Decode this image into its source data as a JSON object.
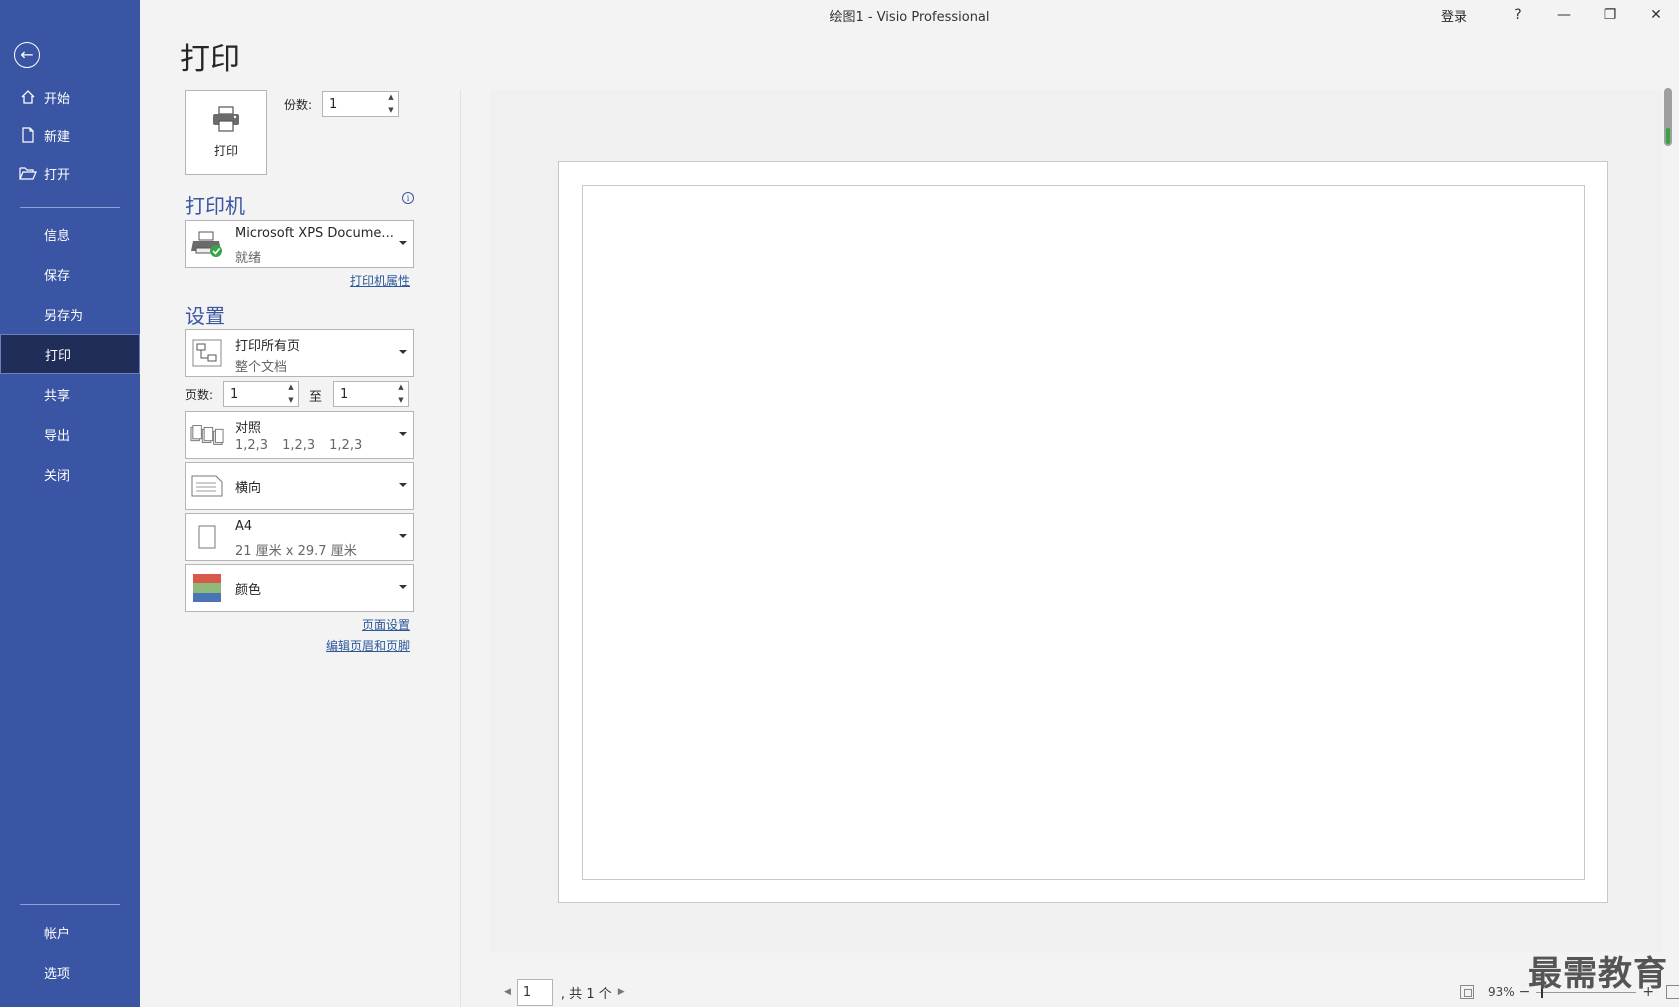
{
  "window": {
    "title": "绘图1  -  Visio Professional",
    "signin": "登录",
    "help": "?",
    "minimize": "—",
    "restore": "❐",
    "close": "✕"
  },
  "sidebar": {
    "back_icon": "←",
    "items": [
      {
        "label": "开始",
        "icon": "home-icon"
      },
      {
        "label": "新建",
        "icon": "new-document-icon"
      },
      {
        "label": "打开",
        "icon": "open-folder-icon"
      },
      {
        "label": "信息"
      },
      {
        "label": "保存"
      },
      {
        "label": "另存为"
      },
      {
        "label": "打印",
        "active": true
      },
      {
        "label": "共享"
      },
      {
        "label": "导出"
      },
      {
        "label": "关闭"
      },
      {
        "label": "帐户"
      },
      {
        "label": "选项"
      }
    ]
  },
  "page": {
    "heading": "打印",
    "print_button_label": "打印",
    "copies_label": "份数:",
    "copies_value": "1",
    "printer_section": "打印机",
    "printer_name": "Microsoft XPS Docume...",
    "printer_status": "就绪",
    "printer_properties": "打印机属性",
    "settings_section": "设置",
    "range_main": "打印所有页",
    "range_sub": "整个文档",
    "pages_label": "页数:",
    "page_from": "1",
    "to_label": "至",
    "page_to": "1",
    "collate_main": "对照",
    "collate_sub": [
      "1,2,3",
      "1,2,3",
      "1,2,3"
    ],
    "orientation": "横向",
    "paper_main": "A4",
    "paper_sub": "21 厘米 x 29.7 厘米",
    "color": "颜色",
    "page_setup_link": "页面设置",
    "header_footer_link": "编辑页眉和页脚"
  },
  "preview": {
    "current_page": "1",
    "of_text": ", 共 1 个",
    "zoom": "93%",
    "zoom_minus": "−",
    "zoom_plus": "+"
  },
  "watermark": "最需教育",
  "colors": {
    "sidebar": "#3955a3",
    "sidebar_active": "#1f2d58",
    "accent": "#3955a3",
    "link": "#2b579a"
  }
}
